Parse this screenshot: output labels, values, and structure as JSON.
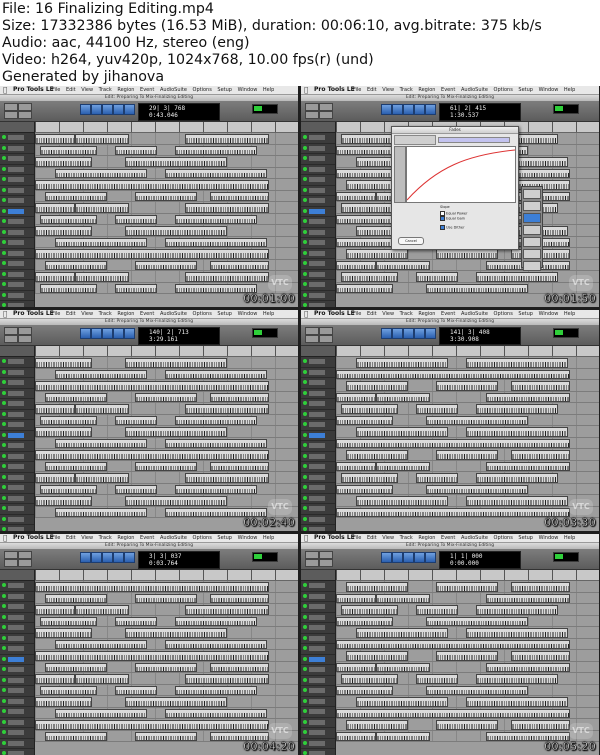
{
  "header": {
    "lines": [
      "File: 16 Finalizing Editing.mp4",
      "Size: 17332386 bytes (16.53 MiB), duration: 00:06:10, avg.bitrate: 375 kb/s",
      "Audio: aac, 44100 Hz, stereo (eng)",
      "Video: h264, yuv420p, 1024x768, 10.00 fps(r) (und)",
      "Generated by jihanova"
    ]
  },
  "app": {
    "apple_icon": "apple-icon",
    "name": "Pro Tools LE",
    "menus": "File Edit View Track Region Event AudioSuite Options Setup Window Help",
    "window_title": "Edit: Preparing To Mix-Finalizing Editing",
    "watermark": "VTC",
    "colors": {
      "window_bg": "#a9a9a9",
      "track_bg": "#9d9d9d",
      "clip_bg": "#dadada",
      "selected": "#3d7fd6",
      "led_green": "#2fcf3a",
      "counter_text": "#f2f2f2"
    }
  },
  "frames": [
    {
      "timestamp": "00:01:00",
      "counter_main": "29| 3| 768",
      "counter_sub": "0:43.046",
      "has_dialog": false
    },
    {
      "timestamp": "00:01:50",
      "counter_main": "61| 2| 415",
      "counter_sub": "1:30.537",
      "has_dialog": true,
      "dialog": {
        "title": "Fades",
        "slope_label": "Slope",
        "options": [
          "Equal Power",
          "Equal Gain",
          "Use Dither"
        ],
        "cancel_label": "Cancel"
      }
    },
    {
      "timestamp": "00:02:40",
      "counter_main": "140| 2| 713",
      "counter_sub": "3:29.161",
      "has_dialog": false
    },
    {
      "timestamp": "00:03:30",
      "counter_main": "141| 3| 408",
      "counter_sub": "3:30.908",
      "has_dialog": false
    },
    {
      "timestamp": "00:04:20",
      "counter_main": "3| 3| 037",
      "counter_sub": "0:03.764",
      "has_dialog": false
    },
    {
      "timestamp": "00:05:20",
      "counter_main": "1| 1| 000",
      "counter_sub": "0:00.000",
      "has_dialog": false
    }
  ]
}
